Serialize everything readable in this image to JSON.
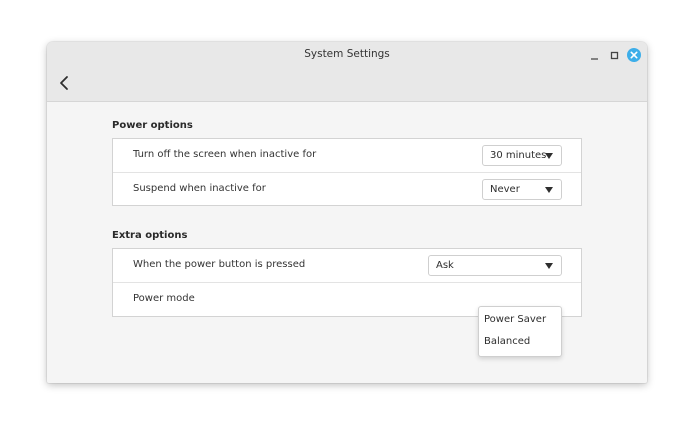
{
  "window": {
    "title": "System Settings",
    "accent_color": "#3daee9"
  },
  "header": {
    "back_icon": "chevron-left-icon",
    "controls": [
      "minimize-icon",
      "maximize-icon",
      "close-icon"
    ]
  },
  "sections": [
    {
      "title": "Power options",
      "rows": [
        {
          "label": "Turn off the screen when inactive for",
          "value": "30 minutes"
        },
        {
          "label": "Suspend when inactive for",
          "value": "Never"
        }
      ]
    },
    {
      "title": "Extra options",
      "rows": [
        {
          "label": "When the power button is pressed",
          "value": "Ask"
        },
        {
          "label": "Power mode"
        }
      ]
    }
  ],
  "power_mode_popup": {
    "options": [
      "Power Saver",
      "Balanced"
    ]
  }
}
